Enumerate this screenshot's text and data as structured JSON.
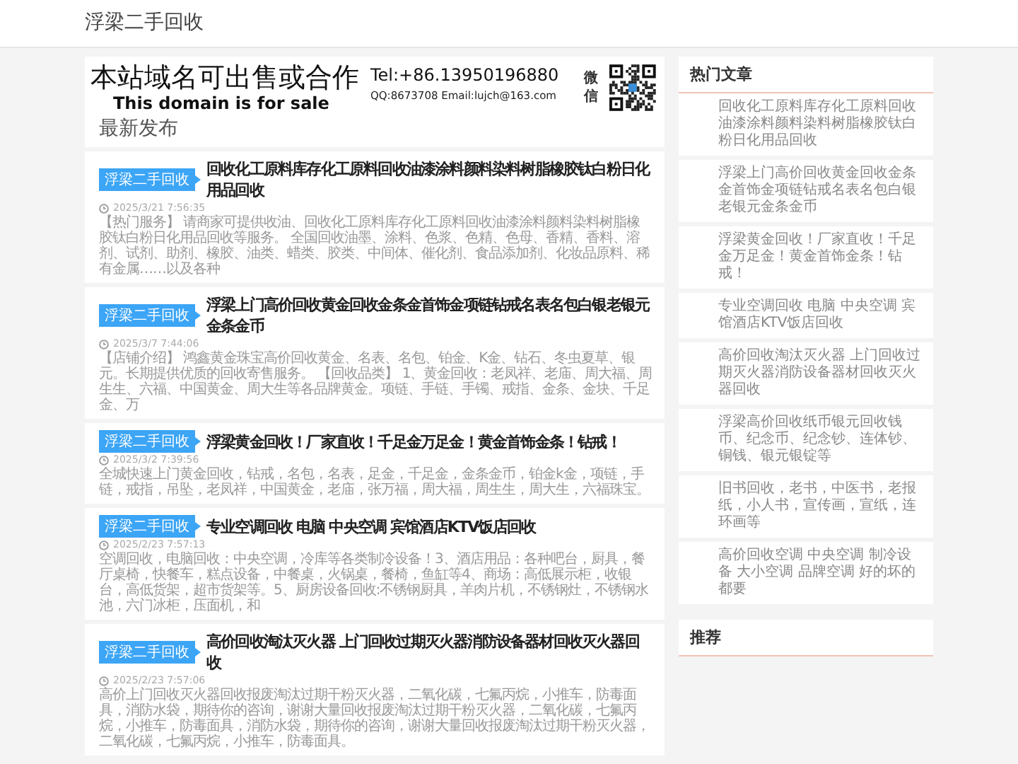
{
  "site": {
    "title": "浮梁二手回收"
  },
  "banner": {
    "headline": "本站域名可出售或合作",
    "subline": "This domain is for sale",
    "phone": "Tel:+86.13950196880",
    "contact": "QQ:8673708 Email:lujch@163.com",
    "wechat_label": "微信"
  },
  "latest": {
    "heading": "最新发布",
    "articles": [
      {
        "tag": "浮梁二手回收",
        "title": "回收化工原料库存化工原料回收油漆涂料颜料染料树脂橡胶钛白粉日化用品回收",
        "date": "2025/3/21 7:56:35",
        "excerpt": [
          "【热门服务】",
          "请商家可提供收油、回收化工原料库存化工原料回收油漆涂料颜料染料树脂橡胶钛白粉日化用品回收等服务。",
          "全国回收油墨、涂料、色浆、色精、色母、香精、香料、溶剂、试剂、助剂、橡胶、油类、蜡类、胶类、中间体、催化剂、食品添加剂、化妆品原料、稀有金属……以及各种"
        ]
      },
      {
        "tag": "浮梁二手回收",
        "title": "浮梁上门高价回收黄金回收金条金首饰金项链钻戒名表名包白银老银元金条金币",
        "date": "2025/3/7 7:44:06",
        "excerpt": [
          "【店铺介绍】",
          "鸿鑫黄金珠宝高价回收黄金、名表、名包、铂金、K金、钻石、冬虫夏草、银元。长期提供优质的回收寄售服务。",
          "【回收品类】",
          "1、黄金回收：老凤祥、老庙、周大福、周生生、六福、中国黄金、周大生等各品牌黄金。项链、手链、手镯、戒指、金条、金块、千足金、万"
        ]
      },
      {
        "tag": "浮梁二手回收",
        "title": "浮梁黄金回收！厂家直收！千足金万足金！黄金首饰金条！钻戒！",
        "date": "2025/3/2 7:39:56",
        "excerpt": [
          "全城快速上门黄金回收，钻戒，名包，名表，足金，千足金，金条金币，铂金k金，项链，手链，戒指，吊坠，老凤祥，中国黄金，老庙，张万福，周大福，周生生，周大生，六福珠宝。"
        ]
      },
      {
        "tag": "浮梁二手回收",
        "title": "专业空调回收 电脑 中央空调 宾馆酒店KTV饭店回收",
        "date": "2025/2/23 7:57:13",
        "excerpt": [
          "空调回收，电脑回收：中央空调，冷库等各类制冷设备！3、酒店用品：各种吧台，厨具，餐厅桌椅，快餐车，糕点设备，中餐桌，火锅桌，餐椅，鱼缸等4、商场：高低展示柜，收银台，高低货架，超市货架等。5、厨房设备回收:不锈钢厨具，羊肉片机，不锈钢灶，不锈钢水池，六门冰柜，压面机，和"
        ]
      },
      {
        "tag": "浮梁二手回收",
        "title": "高价回收淘汰灭火器 上门回收过期灭火器消防设备器材回收灭火器回收",
        "date": "2025/2/23 7:57:06",
        "excerpt": [
          "高价上门回收灭火器回收报废淘汰过期干粉灭火器，二氧化碳，七氟丙烷，小推车，防毒面具，消防水袋，期待你的咨询，谢谢大量回收报废淘汰过期干粉灭火器，二氧化碳，七氟丙烷，小推车，防毒面具，消防水袋，期待你的咨询，谢谢大量回收报废淘汰过期干粉灭火器，二氧化碳，七氟丙烷，小推车，防毒面具。"
        ]
      }
    ]
  },
  "sidebar": {
    "hot": {
      "heading": "热门文章",
      "items": [
        "回收化工原料库存化工原料回收油漆涂料颜料染料树脂橡胶钛白粉日化用品回收",
        "浮梁上门高价回收黄金回收金条金首饰金项链钻戒名表名包白银老银元金条金币",
        "浮梁黄金回收！厂家直收！千足金万足金！黄金首饰金条！钻戒！",
        "专业空调回收 电脑 中央空调 宾馆酒店KTV饭店回收",
        "高价回收淘汰灭火器 上门回收过期灭火器消防设备器材回收灭火器回收",
        "浮梁高价回收纸币银元回收钱币、纪念币、纪念钞、连体钞、铜钱、银元银锭等",
        "旧书回收，老书，中医书，老报纸，小人书，宣传画，宣纸，连环画等",
        "高价回收空调 中央空调 制冷设备 大小空调 品牌空调 好的坏的都要"
      ]
    },
    "recommend": {
      "heading": "推荐"
    }
  }
}
